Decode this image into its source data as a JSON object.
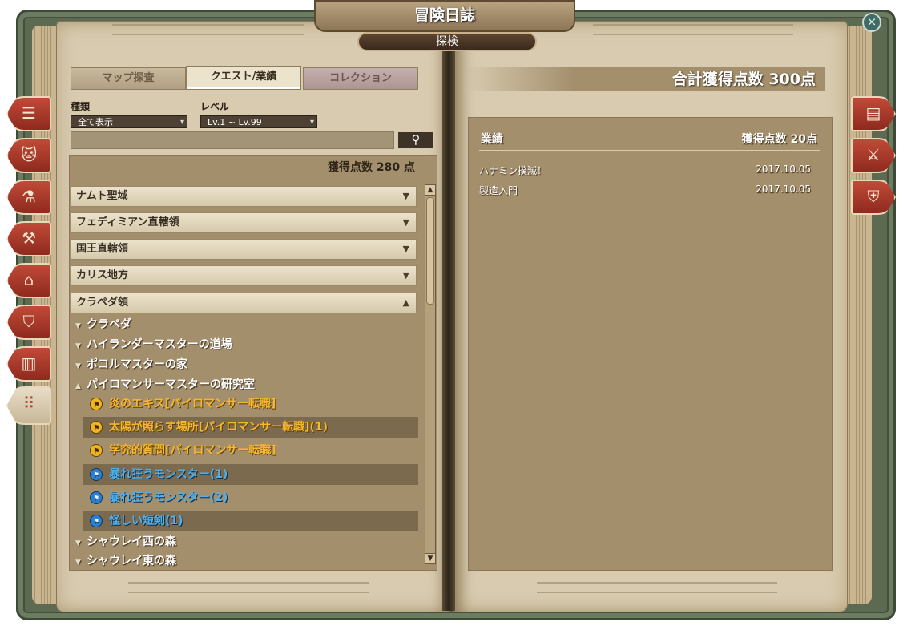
{
  "window": {
    "title": "冒険日誌",
    "subtitle": "探検",
    "close_icon": "close-icon"
  },
  "tabs": [
    {
      "label": "マップ探査"
    },
    {
      "label": "クエスト/業績"
    },
    {
      "label": "コレクション"
    }
  ],
  "filters": {
    "type_label": "種類",
    "type_value": "全て表示",
    "level_label": "レベル",
    "level_value": "Lv.1 ~ Lv.99"
  },
  "left": {
    "points": "獲得点数 280 点"
  },
  "regions": [
    {
      "name": "ナムト聖域",
      "arrow": "▼"
    },
    {
      "name": "フェディミアン直轄領",
      "arrow": "▼"
    },
    {
      "name": "国王直轄領",
      "arrow": "▼"
    },
    {
      "name": "カリス地方",
      "arrow": "▼"
    },
    {
      "name": "クラペダ領",
      "arrow": "▲"
    }
  ],
  "subareas": [
    {
      "tri": "▼",
      "name": "クラペダ"
    },
    {
      "tri": "▼",
      "name": "ハイランダーマスターの道場"
    },
    {
      "tri": "▼",
      "name": "ポコルマスターの家"
    },
    {
      "tri": "▲",
      "name": "パイロマンサーマスターの研究室"
    }
  ],
  "quests": [
    {
      "name": "炎のエキス[パイロマンサー転職]",
      "color": "#f7b72e"
    },
    {
      "name": "太陽が照らす場所[パイロマンサー転職](1)",
      "color": "#f7b72e"
    },
    {
      "name": "学究的質問[パイロマンサー転職]",
      "color": "#f7b72e"
    },
    {
      "name": "暴れ狂うモンスター(1)",
      "color": "#52b0ec"
    },
    {
      "name": "暴れ狂うモンスター(2)",
      "color": "#52b0ec"
    },
    {
      "name": "怪しい短剣(1)",
      "color": "#52b0ec"
    }
  ],
  "subareas_after": [
    {
      "tri": "▼",
      "name": "シャウレイ西の森"
    },
    {
      "tri": "▼",
      "name": "シャウレイ東の森"
    }
  ],
  "right": {
    "total": "合計獲得点数 300点",
    "header_left": "業績",
    "header_right": "獲得点数 20点",
    "rows": [
      {
        "name": "ハナミン撲滅！",
        "date": "2017.10.05"
      },
      {
        "name": "製造入門",
        "date": "2017.10.05"
      }
    ]
  },
  "side_tabs_left": [
    "journal-icon",
    "cat-icon",
    "potion-icon",
    "anvil-icon",
    "house-icon",
    "crest-icon",
    "chart-icon",
    "footprints-icon"
  ],
  "side_tabs_right": [
    "book-icon",
    "crossed-swords-icon",
    "shield-icon"
  ]
}
